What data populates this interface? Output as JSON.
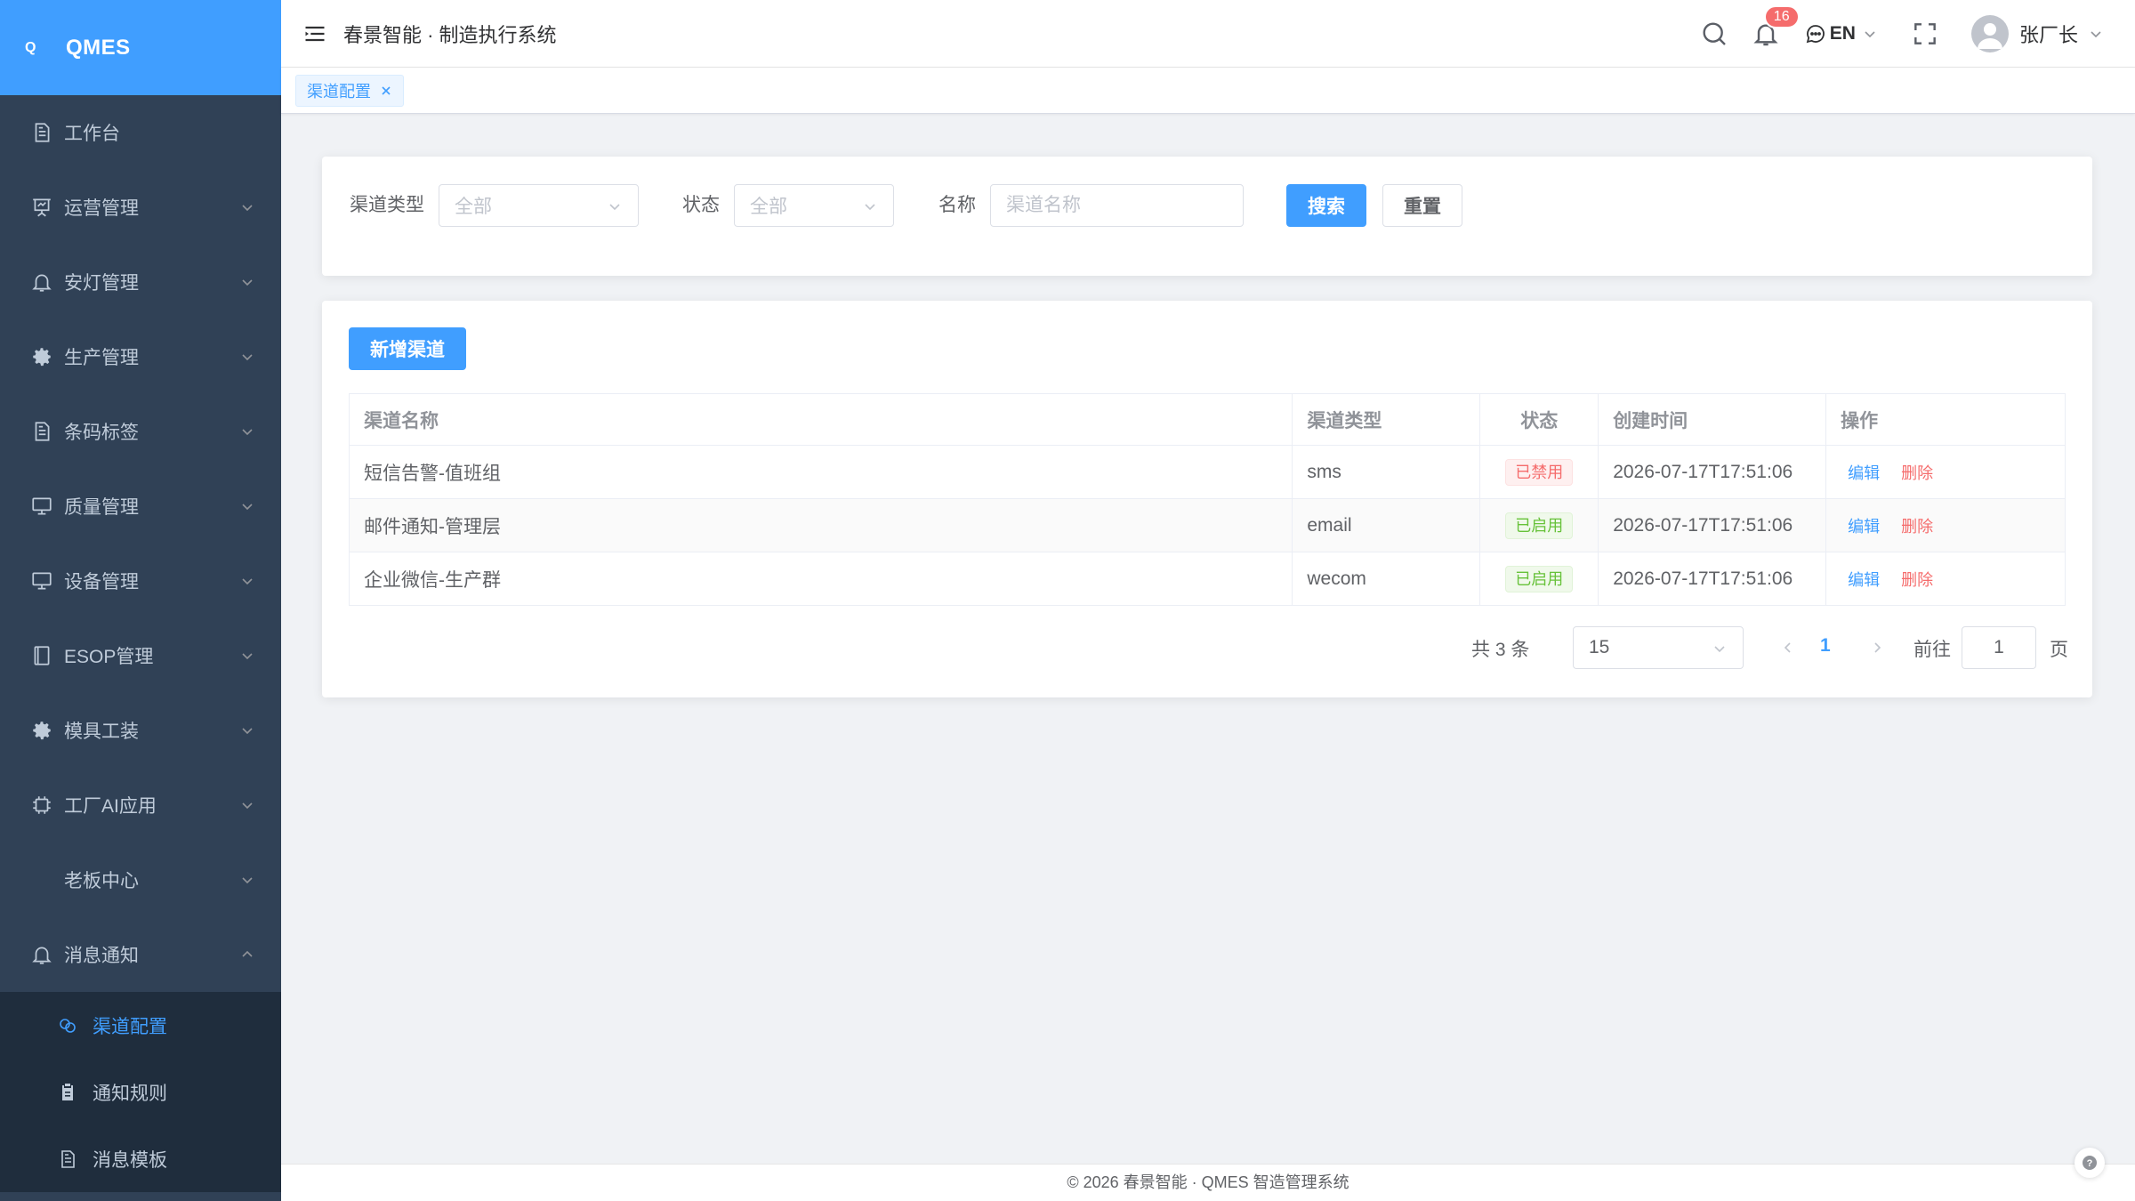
{
  "app": {
    "logo_mark": "Q",
    "logo_text": "QMES",
    "system_title": "春景智能 · 制造执行系统"
  },
  "sidebar": {
    "items": [
      {
        "label": "工作台",
        "icon": "document-icon"
      },
      {
        "label": "运营管理",
        "icon": "presentation-icon"
      },
      {
        "label": "安灯管理",
        "icon": "bell-icon"
      },
      {
        "label": "生产管理",
        "icon": "gear-icon"
      },
      {
        "label": "条码标签",
        "icon": "document-icon"
      },
      {
        "label": "质量管理",
        "icon": "monitor-icon"
      },
      {
        "label": "设备管理",
        "icon": "monitor-icon"
      },
      {
        "label": "ESOP管理",
        "icon": "notebook-icon"
      },
      {
        "label": "模具工装",
        "icon": "gear-icon"
      },
      {
        "label": "工厂AI应用",
        "icon": "cpu-icon"
      },
      {
        "label": "老板中心",
        "icon": ""
      },
      {
        "label": "消息通知",
        "icon": "bell-icon"
      }
    ],
    "sub_items": [
      {
        "label": "渠道配置",
        "icon": "link-icon",
        "active": true
      },
      {
        "label": "通知规则",
        "icon": "clipboard-icon"
      },
      {
        "label": "消息模板",
        "icon": "document-icon"
      }
    ]
  },
  "header": {
    "notification_count": "16",
    "language": "EN",
    "user_name": "张厂长"
  },
  "tabs": [
    {
      "label": "渠道配置"
    }
  ],
  "search": {
    "channel_type_label": "渠道类型",
    "channel_type_value": "全部",
    "status_label": "状态",
    "status_value": "全部",
    "name_label": "名称",
    "name_placeholder": "渠道名称",
    "search_button": "搜索",
    "reset_button": "重置"
  },
  "table": {
    "add_button": "新增渠道",
    "columns": [
      "渠道名称",
      "渠道类型",
      "状态",
      "创建时间",
      "操作"
    ],
    "rows": [
      {
        "name": "短信告警-值班组",
        "type": "sms",
        "status": "已禁用",
        "status_kind": "off",
        "created": "2026-07-17T17:51:06",
        "edit": "编辑",
        "delete": "删除"
      },
      {
        "name": "邮件通知-管理层",
        "type": "email",
        "status": "已启用",
        "status_kind": "on",
        "created": "2026-07-17T17:51:06",
        "edit": "编辑",
        "delete": "删除"
      },
      {
        "name": "企业微信-生产群",
        "type": "wecom",
        "status": "已启用",
        "status_kind": "on",
        "created": "2026-07-17T17:51:06",
        "edit": "编辑",
        "delete": "删除"
      }
    ]
  },
  "pagination": {
    "total_text": "共 3 条",
    "page_size": "15",
    "current_page": "1",
    "goto_label": "前往",
    "goto_value": "1",
    "page_suffix": "页"
  },
  "footer": {
    "text": "© 2026 春景智能 · QMES 智造管理系统"
  },
  "colors": {
    "primary": "#409eff",
    "sidebar_bg": "#304156",
    "danger": "#f56c6c",
    "success": "#67c23a"
  }
}
